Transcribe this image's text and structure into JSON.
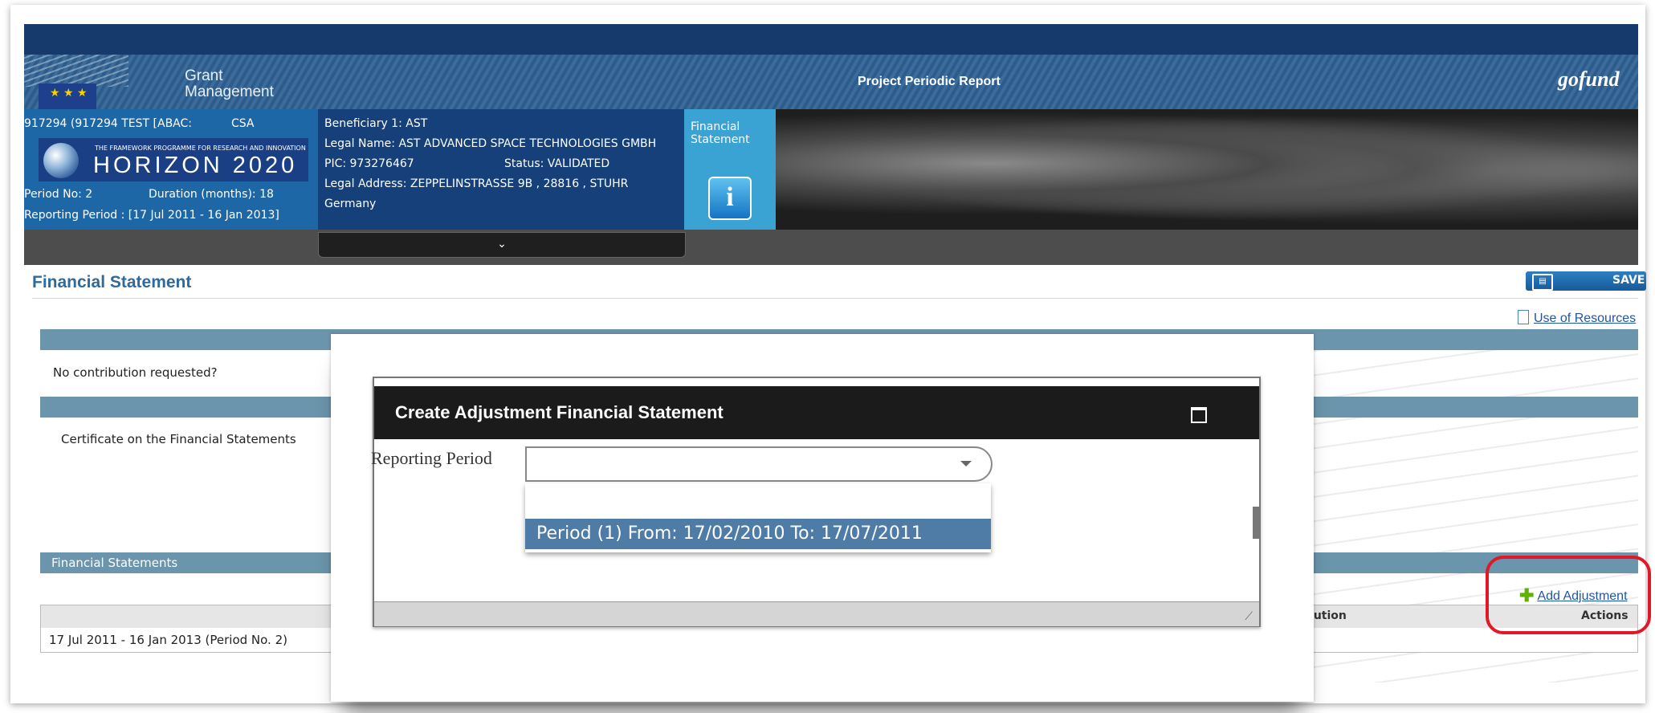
{
  "header": {
    "grant": "Grant",
    "management": "Management",
    "report_title": "Project Periodic Report",
    "brand": "gofund"
  },
  "project": {
    "id_line": "917294 (917294 TEST [ABAC:",
    "csa": "CSA",
    "h2020_small": "THE FRAMEWORK PROGRAMME FOR RESEARCH AND INNOVATION",
    "h2020_big": "HORIZON 2020",
    "period_no": "Period No: 2",
    "duration": "Duration (months): 18",
    "reporting_period": "Reporting Period : [17 Jul 2011 - 16 Jan 2013]"
  },
  "beneficiary": {
    "line1": "Beneficiary 1: AST",
    "legal_name": "Legal Name: AST ADVANCED SPACE TECHNOLOGIES GMBH",
    "pic": "PIC: 973276467",
    "status": "Status: VALIDATED",
    "address": "Legal Address: ZEPPELINSTRASSE 9B , 28816 , STUHR",
    "country": "Germany"
  },
  "fin_tab": {
    "line1": "Financial",
    "line2": "Statement",
    "icon_glyph": "i"
  },
  "page": {
    "title": "Financial Statement",
    "save_label": "SAVE",
    "use_resources": "Use of Resources",
    "no_contribution": "No contribution requested?",
    "certificate": "Certificate on the Financial Statements",
    "fs_section": "Financial Statements",
    "add_adjustment": "Add Adjustment",
    "col_contribution": "ibution",
    "col_actions": "Actions",
    "row_period": "17 Jul 2011 - 16 Jan 2013 (Period No. 2)",
    "row_amount": "€"
  },
  "dialog": {
    "title": "Create Adjustment Financial Statement",
    "reporting_period_label": "Reporting Period",
    "selected_value": "",
    "option": "Period (1) From: 17/02/2010 To: 17/07/2011"
  },
  "icons": {
    "collapse": "chevron-down-icon",
    "save": "save-icon",
    "document": "document-icon",
    "plus": "plus-icon",
    "maximize": "maximize-icon"
  }
}
